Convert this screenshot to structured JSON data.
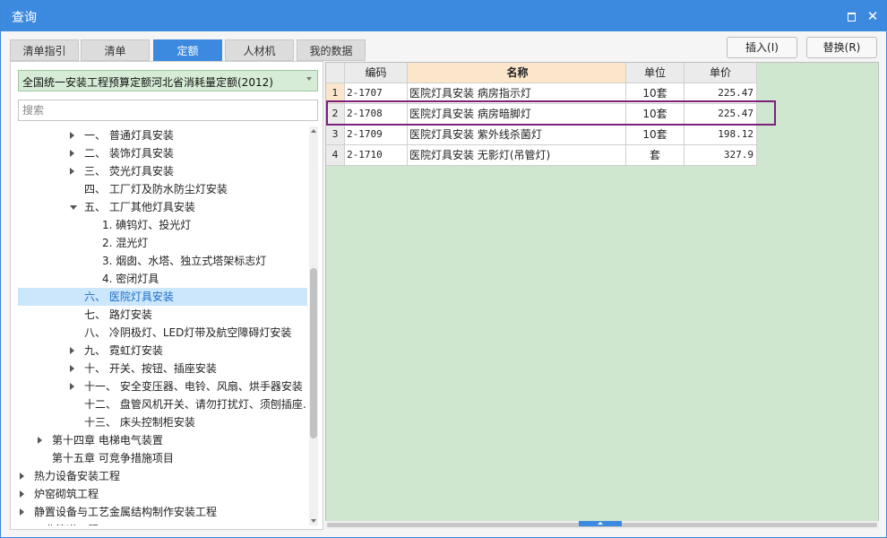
{
  "window": {
    "title": "查询",
    "restore_glyph": "□",
    "close_glyph": "✕"
  },
  "tabs": [
    {
      "label": "清单指引",
      "active": false
    },
    {
      "label": "清单",
      "active": false
    },
    {
      "label": "定额",
      "active": true
    },
    {
      "label": "人材机",
      "active": false
    },
    {
      "label": "我的数据",
      "active": false
    }
  ],
  "toolbar": {
    "insert_label": "插入(I)",
    "replace_label": "替换(R)"
  },
  "left": {
    "standard_value": "全国统一安装工程预算定额河北省消耗量定额(2012)",
    "search_placeholder": "搜索",
    "tree": [
      {
        "label": "一、 普通灯具安装",
        "level": 3,
        "state": "collapsed",
        "selected": false
      },
      {
        "label": "二、 装饰灯具安装",
        "level": 3,
        "state": "collapsed",
        "selected": false
      },
      {
        "label": "三、 荧光灯具安装",
        "level": 3,
        "state": "collapsed",
        "selected": false
      },
      {
        "label": "四、 工厂灯及防水防尘灯安装",
        "level": 3,
        "state": "leaf",
        "selected": false
      },
      {
        "label": "五、 工厂其他灯具安装",
        "level": 3,
        "state": "expanded",
        "selected": false
      },
      {
        "label": "1. 碘钨灯、投光灯",
        "level": 4,
        "state": "leaf",
        "selected": false
      },
      {
        "label": "2. 混光灯",
        "level": 4,
        "state": "leaf",
        "selected": false
      },
      {
        "label": "3. 烟囱、水塔、独立式塔架标志灯",
        "level": 4,
        "state": "leaf",
        "selected": false
      },
      {
        "label": "4. 密闭灯具",
        "level": 4,
        "state": "leaf",
        "selected": false
      },
      {
        "label": "六、 医院灯具安装",
        "level": 3,
        "state": "leaf",
        "selected": true
      },
      {
        "label": "七、 路灯安装",
        "level": 3,
        "state": "leaf",
        "selected": false
      },
      {
        "label": "八、 冷阴极灯、LED灯带及航空障碍灯安装",
        "level": 3,
        "state": "leaf",
        "selected": false
      },
      {
        "label": "九、 霓虹灯安装",
        "level": 3,
        "state": "collapsed",
        "selected": false
      },
      {
        "label": "十、 开关、按钮、插座安装",
        "level": 3,
        "state": "collapsed",
        "selected": false
      },
      {
        "label": "十一、 安全变压器、电铃、风扇、烘手器安装",
        "level": 3,
        "state": "collapsed",
        "selected": false
      },
      {
        "label": "十二、 盘管风机开关、请勿打扰灯、须刨插座...",
        "level": 3,
        "state": "leaf",
        "selected": false
      },
      {
        "label": "十三、 床头控制柜安装",
        "level": 3,
        "state": "leaf",
        "selected": false
      },
      {
        "label": "第十四章 电梯电气装置",
        "level": 2,
        "state": "collapsed",
        "selected": false
      },
      {
        "label": "第十五章 可竞争措施项目",
        "level": 2,
        "state": "leaf",
        "selected": false
      },
      {
        "label": "热力设备安装工程",
        "level": 1,
        "state": "collapsed",
        "selected": false
      },
      {
        "label": "炉窑砌筑工程",
        "level": 1,
        "state": "collapsed",
        "selected": false
      },
      {
        "label": "静置设备与工艺金属结构制作安装工程",
        "level": 1,
        "state": "collapsed",
        "selected": false
      },
      {
        "label": "工业管道工程",
        "level": 1,
        "state": "collapsed",
        "selected": false
      }
    ]
  },
  "grid": {
    "headers": {
      "code": "编码",
      "name": "名称",
      "unit": "单位",
      "price": "单价"
    },
    "rows": [
      {
        "num": "1",
        "code": "2-1707",
        "name": "医院灯具安装 病房指示灯",
        "unit": "10套",
        "price": "225.47"
      },
      {
        "num": "2",
        "code": "2-1708",
        "name": "医院灯具安装 病房暗脚灯",
        "unit": "10套",
        "price": "225.47"
      },
      {
        "num": "3",
        "code": "2-1709",
        "name": "医院灯具安装 紫外线杀菌灯",
        "unit": "10套",
        "price": "198.12"
      },
      {
        "num": "4",
        "code": "2-1710",
        "name": "医院灯具安装 无影灯(吊管灯)",
        "unit": "套",
        "price": "327.9"
      }
    ],
    "current_row": 0,
    "highlighted_row": 1,
    "highlight_color": "#7d1f7d"
  },
  "colors": {
    "accent": "#3c8ae0",
    "grid_bg": "#cfe6cf",
    "standard_bg": "#d6ecd6",
    "header_active": "#fbe6cc"
  }
}
